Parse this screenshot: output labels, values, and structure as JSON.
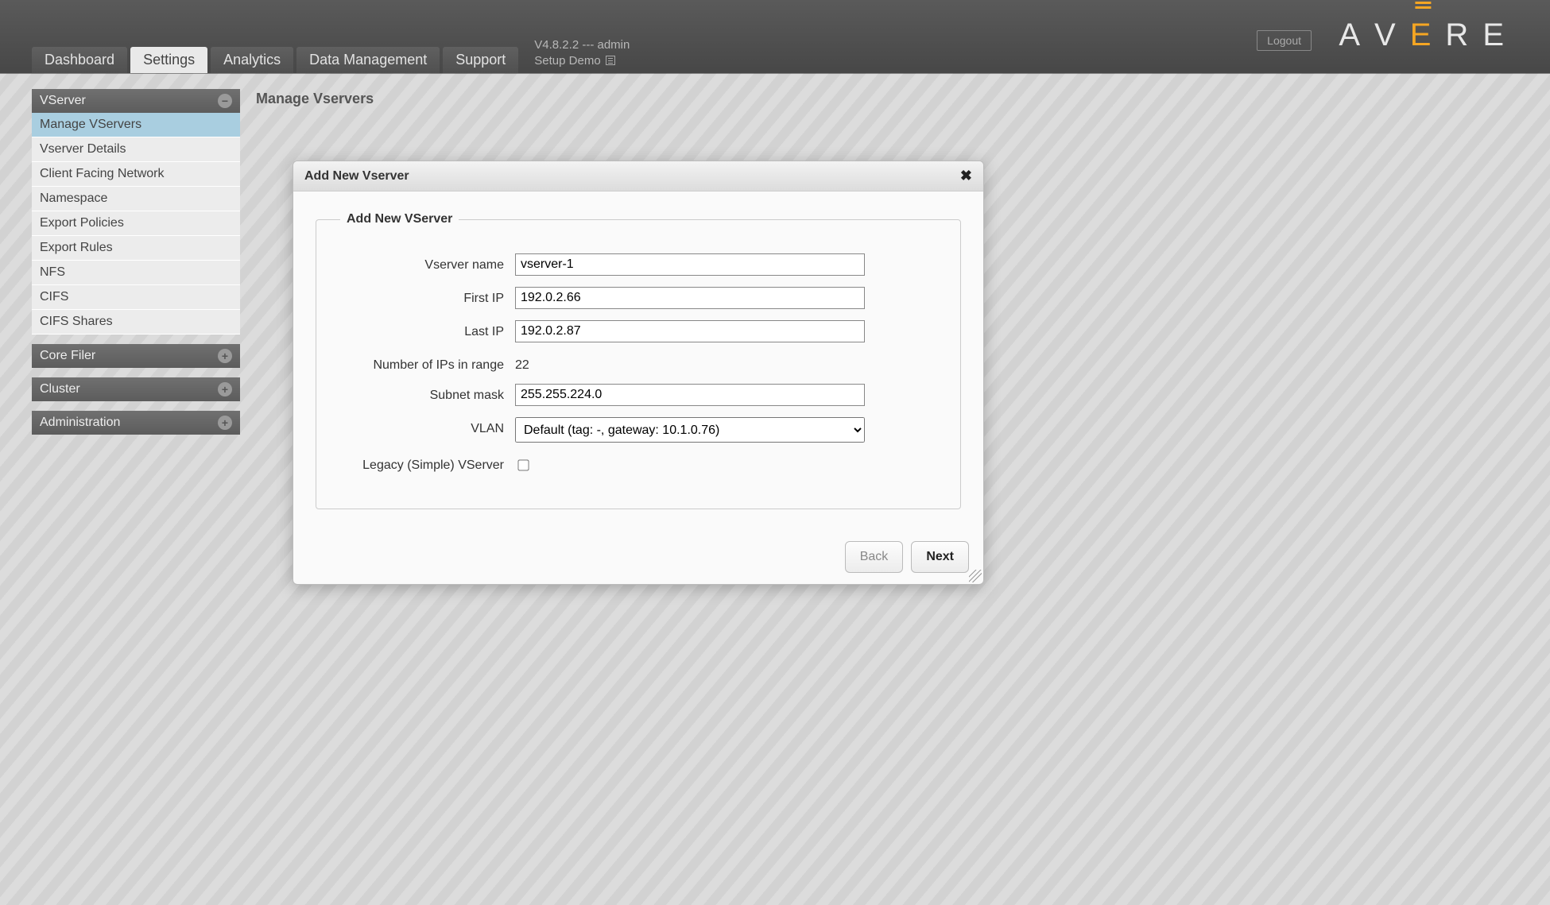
{
  "header": {
    "tabs": [
      "Dashboard",
      "Settings",
      "Analytics",
      "Data Management",
      "Support"
    ],
    "active_tab_index": 1,
    "version_line": "V4.8.2.2 --- admin",
    "setup_line": "Setup Demo",
    "logout_label": "Logout",
    "logo_letters": [
      "A",
      "V",
      "E",
      "R",
      "E"
    ],
    "logo_accent_index": 2
  },
  "sidebar": {
    "sections": [
      {
        "title": "VServer",
        "expanded": true,
        "items": [
          "Manage VServers",
          "Vserver Details",
          "Client Facing Network",
          "Namespace",
          "Export Policies",
          "Export Rules",
          "NFS",
          "CIFS",
          "CIFS Shares"
        ],
        "active_index": 0
      },
      {
        "title": "Core Filer",
        "expanded": false,
        "items": []
      },
      {
        "title": "Cluster",
        "expanded": false,
        "items": []
      },
      {
        "title": "Administration",
        "expanded": false,
        "items": []
      }
    ]
  },
  "page": {
    "title": "Manage Vservers"
  },
  "dialog": {
    "title": "Add New Vserver",
    "legend": "Add New VServer",
    "labels": {
      "name": "Vserver name",
      "first_ip": "First IP",
      "last_ip": "Last IP",
      "count": "Number of IPs in range",
      "mask": "Subnet mask",
      "vlan": "VLAN",
      "legacy": "Legacy (Simple) VServer"
    },
    "values": {
      "name": "vserver-1",
      "first_ip": "192.0.2.66",
      "last_ip": "192.0.2.87",
      "count": "22",
      "mask": "255.255.224.0",
      "vlan_selected": "Default (tag: -, gateway: 10.1.0.76)",
      "legacy_checked": false
    },
    "buttons": {
      "back": "Back",
      "next": "Next"
    }
  }
}
